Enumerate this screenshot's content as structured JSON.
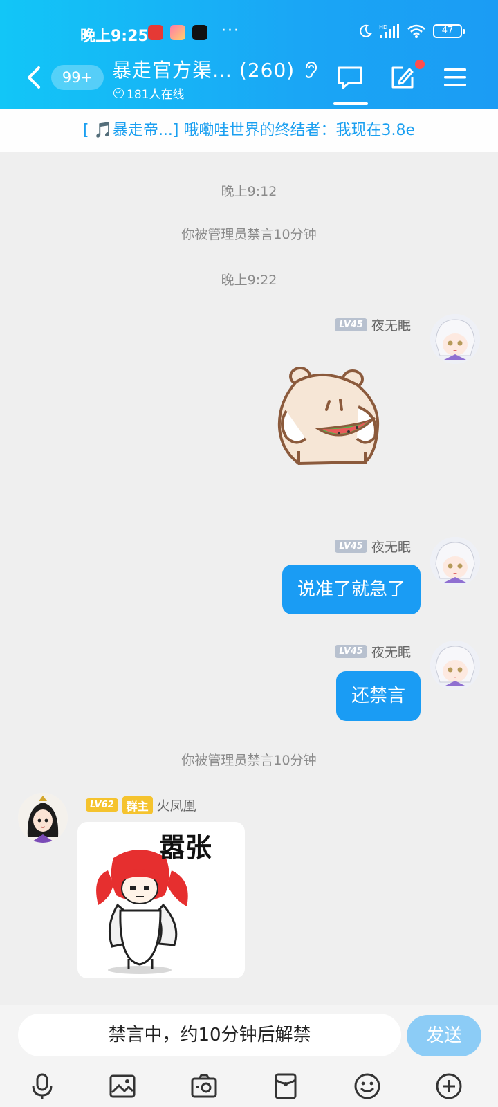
{
  "status_bar": {
    "time": "晚上9:25",
    "more": "···",
    "battery": "47"
  },
  "header": {
    "unread_badge": "99+",
    "group_title": "暴走官方渠… (260)",
    "online": "181人在线"
  },
  "notice": {
    "text": "[ 🎵暴走帝...] 哦嘞哇世界的终结者：我现在3.8e"
  },
  "chat": {
    "time1": "晚上9:12",
    "sys_muted_1": "你被管理员禁言10分钟",
    "time2": "晚上9:22",
    "messages": [
      {
        "level": "LV45",
        "name": "夜无眠",
        "type": "sticker"
      },
      {
        "level": "LV45",
        "name": "夜无眠",
        "text": "说准了就急了"
      },
      {
        "level": "LV45",
        "name": "夜无眠",
        "text": "还禁言"
      }
    ],
    "sys_muted_2": "你被管理员禁言10分钟",
    "owner_msg": {
      "level": "LV62",
      "role": "群主",
      "name": "火凤凰",
      "sticker_caption": "嚣张"
    }
  },
  "input": {
    "placeholder": "禁言中，约10分钟后解禁",
    "send": "发送"
  },
  "colors": {
    "header_start": "#12c6f7",
    "bubble": "#1a9cf4",
    "send_disabled": "#8cccf6",
    "notice_text": "#1a9ff0"
  }
}
